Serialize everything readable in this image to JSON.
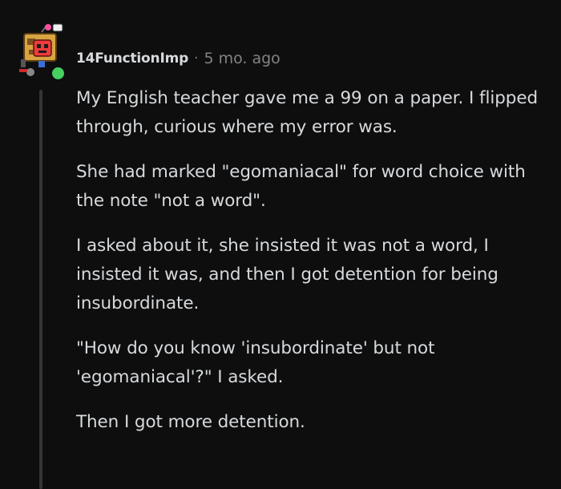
{
  "comment": {
    "author": "14FunctionImp",
    "separator": "·",
    "time_ago": "5 mo. ago",
    "avatar_icon": "robot-snoo-avatar-icon",
    "online_status": "online",
    "paragraphs": [
      "My English teacher gave me a 99 on a paper. I flipped through, curious where my error was.",
      "She had marked \"egomaniacal\" for word choice with the note \"not a word\".",
      "I asked about it, she insisted it was not a word, I insisted it was, and then I got detention for being insubordinate.",
      "\"How do you know 'insubordinate' but not 'egomaniacal'?\" I asked.",
      "Then I got more detention."
    ]
  },
  "colors": {
    "background": "#0e0e0f",
    "text": "#d7dadc",
    "meta": "#818384",
    "online": "#46d160",
    "thread_line": "#343536"
  }
}
